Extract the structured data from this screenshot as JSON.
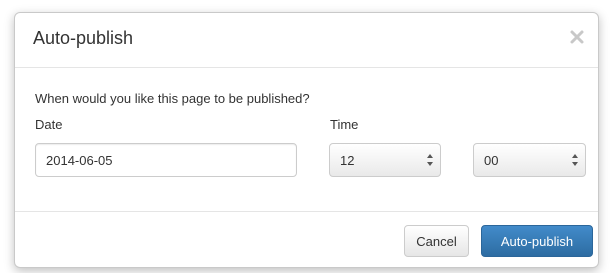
{
  "dialog": {
    "title": "Auto-publish",
    "close_glyph": "×",
    "question": "When would you like this page to be published?",
    "date_label": "Date",
    "date_value": "2014-06-05",
    "time_label": "Time",
    "hour_value": "12",
    "minute_value": "00",
    "cancel_label": "Cancel",
    "publish_label": "Auto-publish"
  },
  "colors": {
    "primary": "#428bca",
    "border": "#cccccc",
    "text": "#333333"
  },
  "icons": {
    "close": "close-icon",
    "select_arrows": "up-down-arrows-icon"
  }
}
